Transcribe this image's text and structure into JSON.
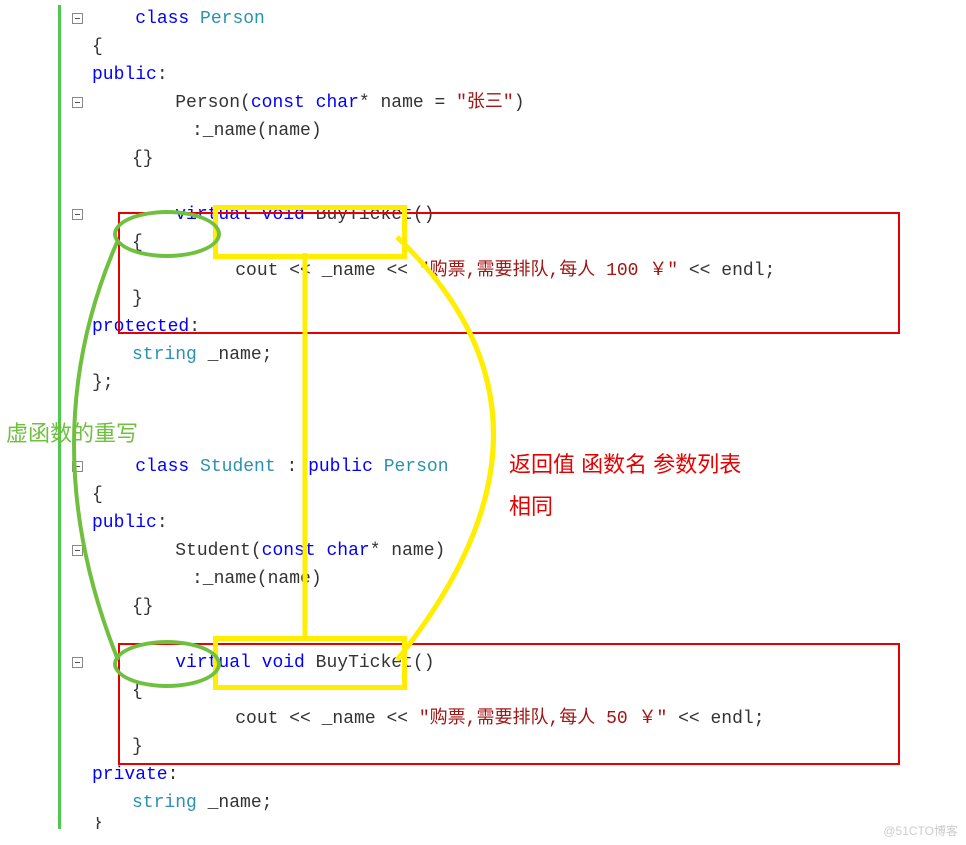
{
  "code": {
    "class_kw": "class",
    "person": "Person",
    "student": "Student",
    "open_brace": "{",
    "close_brace": "}",
    "close_brace_semi": "};",
    "public": "public",
    "protected": "protected",
    "private": "private",
    "colon": ":",
    "const": "const",
    "char": "char",
    "star": "*",
    "name_param": " name = ",
    "name_param2": " name)",
    "zhangsan": "\"张三\"",
    "paren_close": ")",
    "init_name": ":_name(name)",
    "empty_braces": "{}",
    "virtual": "virtual",
    "void": "void",
    "buy_ticket": " BuyTicket()",
    "cout": "cout << _name << ",
    "msg1": "\"购票,需要排队,每人 100 ￥\"",
    "msg2": "\"购票,需要排队,每人 50 ￥\"",
    "endl": " << endl;",
    "string": "string",
    "name_member": " _name;",
    "inherit": " : ",
    "student_ctor": "Student("
  },
  "annotations": {
    "green_label": "虚函数的重写",
    "red_line1": "返回值 函数名  参数列表",
    "red_line2": "相同"
  },
  "watermark": "@51CTO博客",
  "chart_data": null
}
